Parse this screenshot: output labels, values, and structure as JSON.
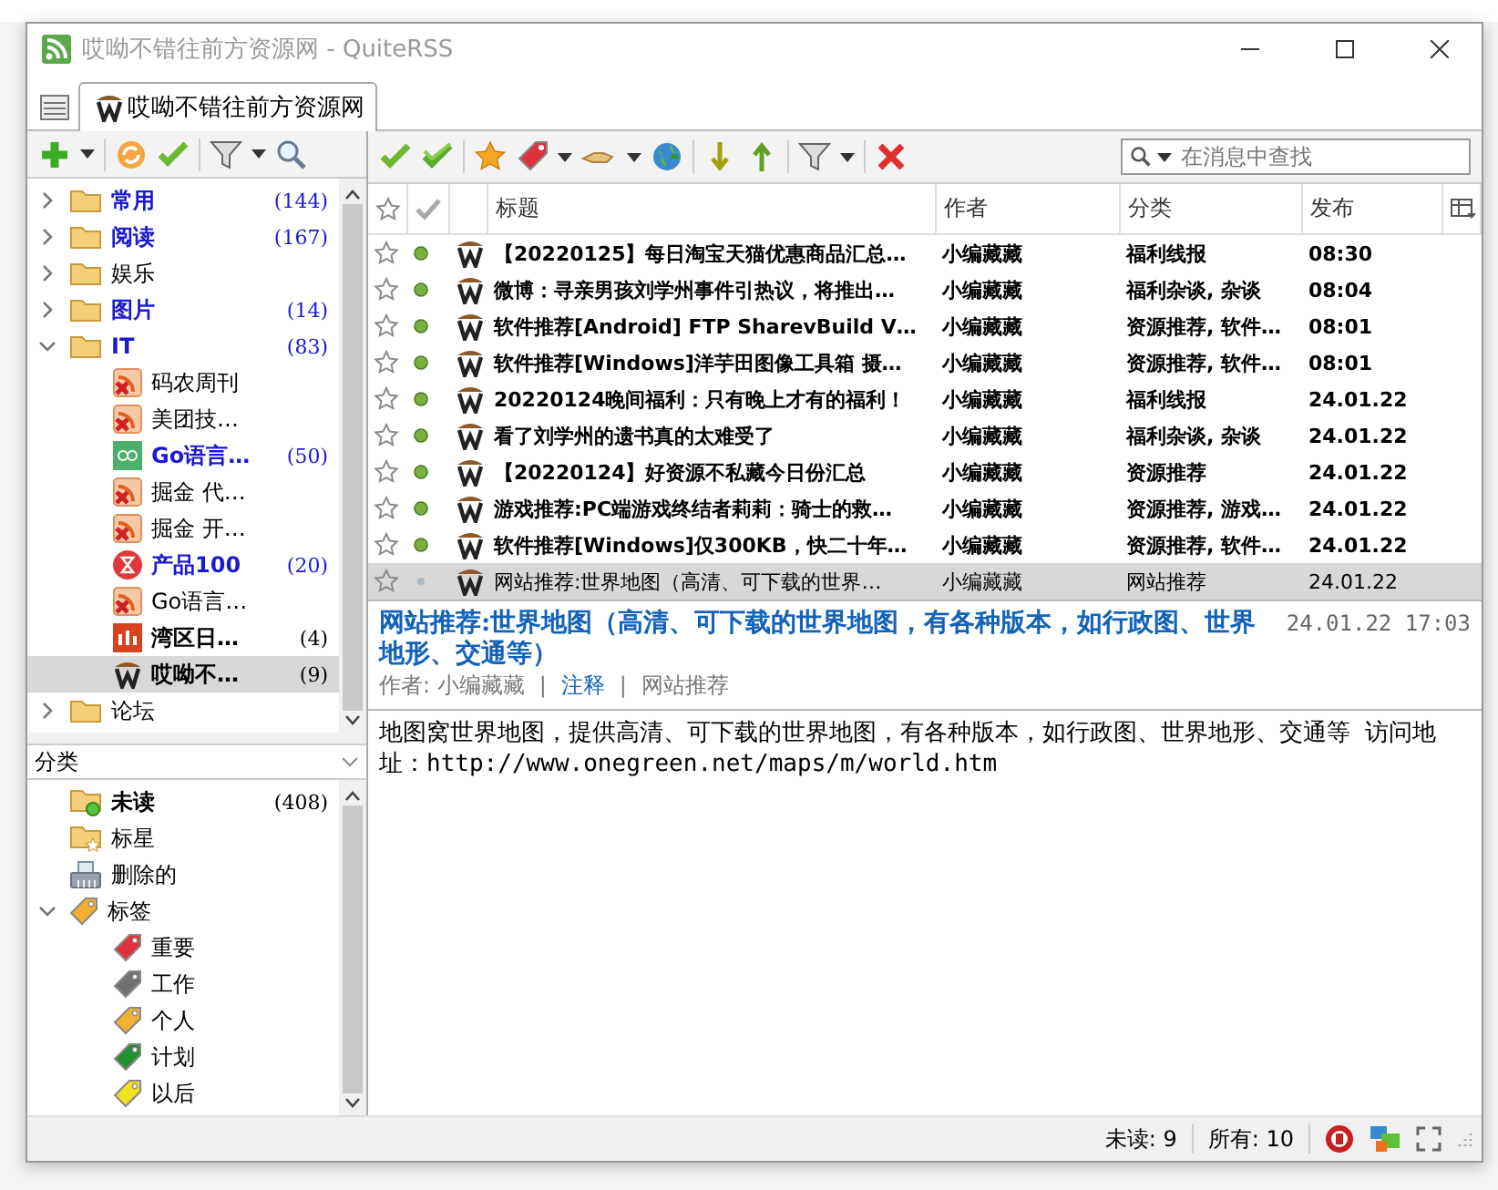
{
  "window": {
    "title": "哎呦不错往前方资源网 - QuiteRSS"
  },
  "tabs": [
    {
      "label": "哎呦不错往前方资源网",
      "selected": true
    }
  ],
  "search": {
    "placeholder": "在消息中查找"
  },
  "feeds": [
    {
      "kind": "folder",
      "name": "常用",
      "count": "(144)",
      "unread": true,
      "new": true,
      "expanded": false,
      "selected": false
    },
    {
      "kind": "folder",
      "name": "阅读",
      "count": "(167)",
      "unread": true,
      "new": true,
      "expanded": false,
      "selected": false
    },
    {
      "kind": "folder",
      "name": "娱乐",
      "unread": false,
      "new": false,
      "expanded": false,
      "selected": false
    },
    {
      "kind": "folder",
      "name": "图片",
      "count": "(14)",
      "unread": true,
      "new": true,
      "expanded": false,
      "selected": false
    },
    {
      "kind": "folder",
      "name": "IT",
      "count": "(83)",
      "unread": true,
      "new": true,
      "expanded": true,
      "selected": false,
      "children": [
        {
          "kind": "rss-error",
          "name": "码农周刊",
          "unread": false,
          "new": false,
          "selected": false
        },
        {
          "kind": "rss-error",
          "name": "美团技…",
          "unread": false,
          "new": false,
          "selected": false
        },
        {
          "kind": "go",
          "name": "Go语言…",
          "count": "(50)",
          "unread": true,
          "new": true,
          "selected": false
        },
        {
          "kind": "rss-error",
          "name": "掘金 代…",
          "unread": false,
          "new": false,
          "selected": false
        },
        {
          "kind": "rss-error",
          "name": "掘金 开…",
          "unread": false,
          "new": false,
          "selected": false
        },
        {
          "kind": "hourglass",
          "name": "产品100",
          "count": "(20)",
          "unread": true,
          "new": true,
          "selected": false
        },
        {
          "kind": "rss-error",
          "name": "Go语言…",
          "unread": false,
          "new": false,
          "selected": false
        },
        {
          "kind": "bars",
          "name": "湾区日…",
          "count": "(4)",
          "unread": true,
          "new": false,
          "selected": false
        },
        {
          "kind": "site",
          "name": "哎呦不…",
          "count": "(9)",
          "unread": true,
          "new": false,
          "selected": true
        }
      ]
    },
    {
      "kind": "folder",
      "name": "论坛",
      "unread": false,
      "new": false,
      "expanded": false,
      "selected": false
    }
  ],
  "categories": {
    "title": "分类",
    "items": [
      {
        "kind": "unread",
        "name": "未读",
        "count": "(408)",
        "unread": true
      },
      {
        "kind": "starred",
        "name": "标星",
        "unread": false
      },
      {
        "kind": "deleted",
        "name": "删除的",
        "unread": false
      },
      {
        "kind": "labels",
        "name": "标签",
        "unread": false,
        "expanded": true,
        "color": "#f0b030",
        "children": [
          {
            "kind": "label",
            "name": "重要",
            "color": "#e0303c",
            "unread": false
          },
          {
            "kind": "label",
            "name": "工作",
            "color": "#707070",
            "unread": false
          },
          {
            "kind": "label",
            "name": "个人",
            "color": "#f0b030",
            "unread": false
          },
          {
            "kind": "label",
            "name": "计划",
            "color": "#209030",
            "unread": false
          },
          {
            "kind": "label",
            "name": "以后",
            "color": "#f0e020",
            "unread": false
          }
        ]
      }
    ]
  },
  "table": {
    "columns": [
      "标题",
      "作者",
      "分类",
      "发布"
    ],
    "rows": [
      {
        "title": "【20220125】每日淘宝天猫优惠商品汇总…",
        "author": "小编藏藏",
        "category": "福利线报",
        "published": "08:30",
        "unread": true,
        "starred": false,
        "selected": false
      },
      {
        "title": "微博：寻亲男孩刘学州事件引热议，将推出…",
        "author": "小编藏藏",
        "category": "福利杂谈, 杂谈",
        "published": "08:04",
        "unread": true,
        "starred": false,
        "selected": false
      },
      {
        "title": "软件推荐[Android] FTP SharevBuild V…",
        "author": "小编藏藏",
        "category": "资源推荐, 软件…",
        "published": "08:01",
        "unread": true,
        "starred": false,
        "selected": false
      },
      {
        "title": "软件推荐[Windows]洋芋田图像工具箱 摄…",
        "author": "小编藏藏",
        "category": "资源推荐, 软件…",
        "published": "08:01",
        "unread": true,
        "starred": false,
        "selected": false
      },
      {
        "title": "20220124晚间福利：只有晚上才有的福利！",
        "author": "小编藏藏",
        "category": "福利线报",
        "published": "24.01.22",
        "unread": true,
        "starred": false,
        "selected": false
      },
      {
        "title": "看了刘学州的遗书真的太难受了",
        "author": "小编藏藏",
        "category": "福利杂谈, 杂谈",
        "published": "24.01.22",
        "unread": true,
        "starred": false,
        "selected": false
      },
      {
        "title": "【20220124】好资源不私藏今日份汇总",
        "author": "小编藏藏",
        "category": "资源推荐",
        "published": "24.01.22",
        "unread": true,
        "starred": false,
        "selected": false
      },
      {
        "title": "游戏推荐:PC端游戏终结者莉莉：骑士的救…",
        "author": "小编藏藏",
        "category": "资源推荐, 游戏…",
        "published": "24.01.22",
        "unread": true,
        "starred": false,
        "selected": false
      },
      {
        "title": "软件推荐[Windows]仅300KB，快二十年…",
        "author": "小编藏藏",
        "category": "资源推荐, 软件…",
        "published": "24.01.22",
        "unread": true,
        "starred": false,
        "selected": false
      },
      {
        "title": "网站推荐:世界地图（高清、可下载的世界…",
        "author": "小编藏藏",
        "category": "网站推荐",
        "published": "24.01.22",
        "unread": false,
        "starred": false,
        "selected": true
      }
    ]
  },
  "preview": {
    "title": "网站推荐:世界地图（高清、可下载的世界地图，有各种版本，如行政图、世界地形、交通等）",
    "date": "24.01.22 17:03",
    "author_label": "作者: 小编藏藏",
    "separator_1": "|",
    "note": "注释",
    "separator_2": "|",
    "category": "网站推荐",
    "body": "地图窝世界地图，提供高清、可下载的世界地图，有各种版本，如行政图、世界地形、交通等 访问地址：http://www.onegreen.net/maps/m/world.htm"
  },
  "status_bar": {
    "unread": "未读: 9",
    "all": "所有: 10"
  }
}
